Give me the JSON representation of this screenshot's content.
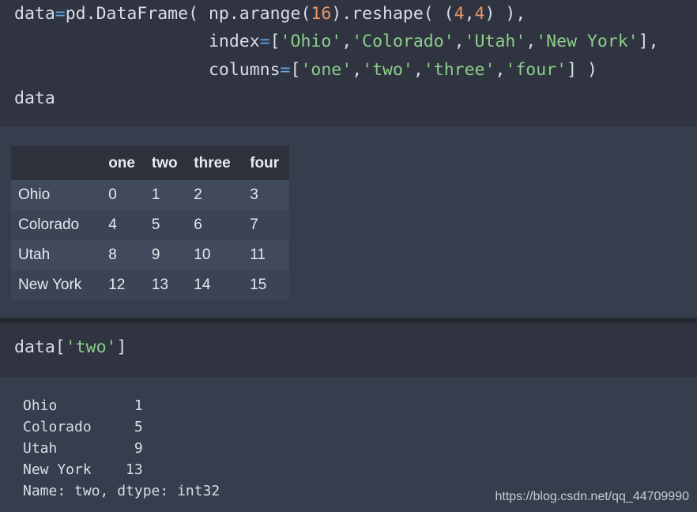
{
  "cell1": {
    "line1": {
      "a": "data",
      "eq": "=",
      "b": "pd.DataFrame( np.arange(",
      "n16": "16",
      "c": ").reshape( (",
      "n4a": "4",
      ",": ",",
      "n4b": "4",
      "d": ") ),"
    },
    "line2": {
      "pad": "                   index",
      "eq": "=",
      "a": "[",
      "s1": "'Ohio'",
      "s2": "'Colorado'",
      "s3": "'Utah'",
      "s4": "'New York'",
      "b": "],"
    },
    "line3": {
      "pad": "                   columns",
      "eq": "=",
      "a": "[",
      "s1": "'one'",
      "s2": "'two'",
      "s3": "'three'",
      "s4": "'four'",
      "b": "] )"
    },
    "line4": "data"
  },
  "table": {
    "columns": [
      "",
      "one",
      "two",
      "three",
      "four"
    ],
    "rows": [
      [
        "Ohio",
        "0",
        "1",
        "2",
        "3"
      ],
      [
        "Colorado",
        "4",
        "5",
        "6",
        "7"
      ],
      [
        "Utah",
        "8",
        "9",
        "10",
        "11"
      ],
      [
        "New York",
        "12",
        "13",
        "14",
        "15"
      ]
    ]
  },
  "cell2": {
    "a": "data[",
    "s": "'two'",
    "b": "]"
  },
  "series": [
    "Ohio         1",
    "Colorado     5",
    "Utah         9",
    "New York    13",
    "Name: two, dtype: int32"
  ],
  "watermark": "https://blog.csdn.net/qq_44709990"
}
